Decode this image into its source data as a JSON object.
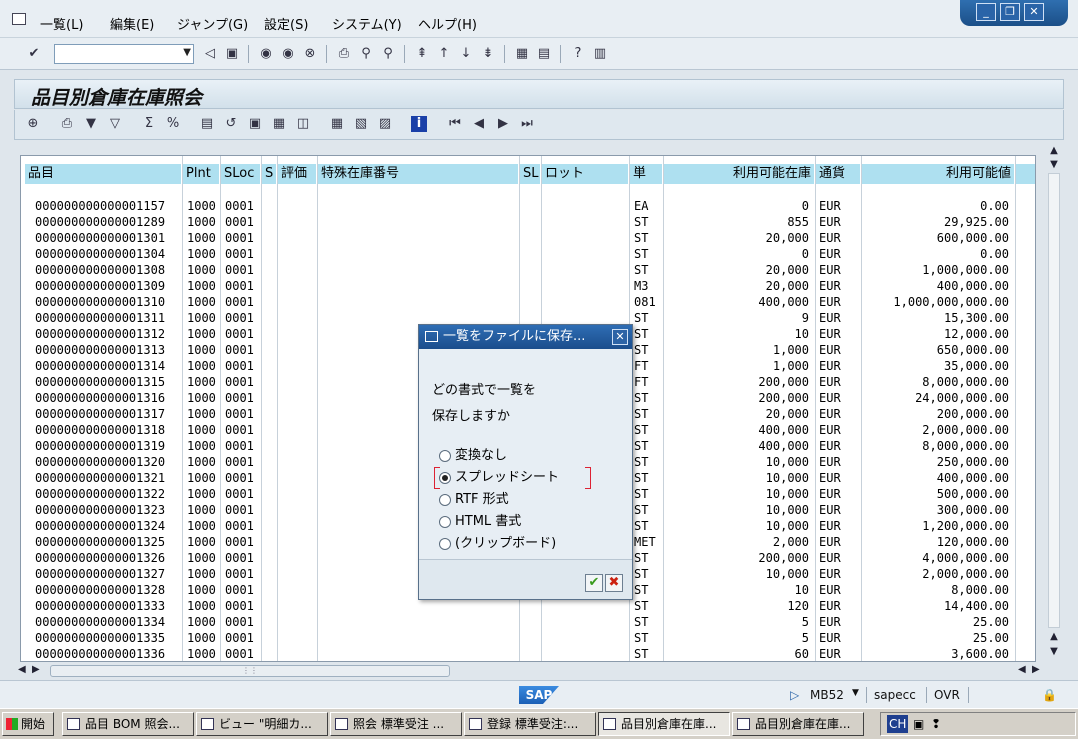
{
  "menu": {
    "items": [
      "一覧(L)",
      "編集(E)",
      "ジャンプ(G)",
      "設定(S)",
      "システム(Y)",
      "ヘルプ(H)"
    ]
  },
  "window_controls": {
    "minimize": "_",
    "restore": "❐",
    "close": "✕"
  },
  "toolbar": {
    "command_field": "",
    "icons": [
      "enter-icon",
      "back-icon",
      "save-icon",
      "back-nav-icon",
      "exit-icon",
      "cancel-icon",
      "print-icon",
      "find-icon",
      "find-next-icon",
      "first-page-icon",
      "prev-page-icon",
      "next-page-icon",
      "last-page-icon",
      "new-session-icon",
      "shortcut-icon",
      "help-icon",
      "layout-icon"
    ]
  },
  "title": "品目別倉庫在庫照会",
  "app_toolbar": {
    "icons": [
      "details-icon",
      "print-icon",
      "filter-icon",
      "filter-off-icon",
      "sum-icon",
      "subtotal-icon",
      "export-icon",
      "layout-change-icon",
      "layout-select-icon",
      "layout-save-icon",
      "abc-icon",
      "grid-icon",
      "insert-column-icon",
      "delete-column-icon",
      "info-icon",
      "first-icon",
      "prev-icon",
      "next-icon",
      "last-icon"
    ]
  },
  "grid": {
    "headers": [
      "品目",
      "Plnt",
      "SLoc",
      "S",
      "評価",
      "特殊在庫番号",
      "SL",
      "ロット",
      "単",
      "利用可能在庫",
      "通貨",
      "利用可能値"
    ],
    "rows": [
      [
        "000000000000001157",
        "1000",
        "0001",
        "EA",
        "0",
        "EUR",
        "0.00"
      ],
      [
        "000000000000001289",
        "1000",
        "0001",
        "ST",
        "855",
        "EUR",
        "29,925.00"
      ],
      [
        "000000000000001301",
        "1000",
        "0001",
        "ST",
        "20,000",
        "EUR",
        "600,000.00"
      ],
      [
        "000000000000001304",
        "1000",
        "0001",
        "ST",
        "0",
        "EUR",
        "0.00"
      ],
      [
        "000000000000001308",
        "1000",
        "0001",
        "ST",
        "20,000",
        "EUR",
        "1,000,000.00"
      ],
      [
        "000000000000001309",
        "1000",
        "0001",
        "M3",
        "20,000",
        "EUR",
        "400,000.00"
      ],
      [
        "000000000000001310",
        "1000",
        "0001",
        "081",
        "400,000",
        "EUR",
        "1,000,000,000.00"
      ],
      [
        "000000000000001311",
        "1000",
        "0001",
        "ST",
        "9",
        "EUR",
        "15,300.00"
      ],
      [
        "000000000000001312",
        "1000",
        "0001",
        "ST",
        "10",
        "EUR",
        "12,000.00"
      ],
      [
        "000000000000001313",
        "1000",
        "0001",
        "ST",
        "1,000",
        "EUR",
        "650,000.00"
      ],
      [
        "000000000000001314",
        "1000",
        "0001",
        "FT",
        "1,000",
        "EUR",
        "35,000.00"
      ],
      [
        "000000000000001315",
        "1000",
        "0001",
        "FT",
        "200,000",
        "EUR",
        "8,000,000.00"
      ],
      [
        "000000000000001316",
        "1000",
        "0001",
        "ST",
        "200,000",
        "EUR",
        "24,000,000.00"
      ],
      [
        "000000000000001317",
        "1000",
        "0001",
        "ST",
        "20,000",
        "EUR",
        "200,000.00"
      ],
      [
        "000000000000001318",
        "1000",
        "0001",
        "ST",
        "400,000",
        "EUR",
        "2,000,000.00"
      ],
      [
        "000000000000001319",
        "1000",
        "0001",
        "ST",
        "400,000",
        "EUR",
        "8,000,000.00"
      ],
      [
        "000000000000001320",
        "1000",
        "0001",
        "ST",
        "10,000",
        "EUR",
        "250,000.00"
      ],
      [
        "000000000000001321",
        "1000",
        "0001",
        "ST",
        "10,000",
        "EUR",
        "400,000.00"
      ],
      [
        "000000000000001322",
        "1000",
        "0001",
        "ST",
        "10,000",
        "EUR",
        "500,000.00"
      ],
      [
        "000000000000001323",
        "1000",
        "0001",
        "ST",
        "10,000",
        "EUR",
        "300,000.00"
      ],
      [
        "000000000000001324",
        "1000",
        "0001",
        "ST",
        "10,000",
        "EUR",
        "1,200,000.00"
      ],
      [
        "000000000000001325",
        "1000",
        "0001",
        "MET",
        "2,000",
        "EUR",
        "120,000.00"
      ],
      [
        "000000000000001326",
        "1000",
        "0001",
        "ST",
        "200,000",
        "EUR",
        "4,000,000.00"
      ],
      [
        "000000000000001327",
        "1000",
        "0001",
        "ST",
        "10,000",
        "EUR",
        "2,000,000.00"
      ],
      [
        "000000000000001328",
        "1000",
        "0001",
        "ST",
        "10",
        "EUR",
        "8,000.00"
      ],
      [
        "000000000000001333",
        "1000",
        "0001",
        "ST",
        "120",
        "EUR",
        "14,400.00"
      ],
      [
        "000000000000001334",
        "1000",
        "0001",
        "ST",
        "5",
        "EUR",
        "25.00"
      ],
      [
        "000000000000001335",
        "1000",
        "0001",
        "ST",
        "5",
        "EUR",
        "25.00"
      ],
      [
        "000000000000001336",
        "1000",
        "0001",
        "ST",
        "60",
        "EUR",
        "3,600.00"
      ]
    ]
  },
  "dialog": {
    "title": "一覧をファイルに保存...",
    "question_line1": "どの書式で一覧を",
    "question_line2": "保存しますか",
    "options": [
      "変換なし",
      "スプレッドシート",
      "RTF 形式",
      "HTML 書式",
      "(クリップボード)"
    ],
    "selected_index": 1,
    "ok_label": "✔",
    "cancel_label": "✖"
  },
  "status": {
    "logo": "SAP",
    "transaction": "MB52",
    "server": "sapecc",
    "mode": "OVR"
  },
  "taskbar": {
    "start_label": "開始",
    "buttons": [
      "品目 BOM 照会...",
      "ビュー \"明細カ...",
      "照会 標準受注 ...",
      "登録 標準受注:...",
      "品目別倉庫在庫...",
      "品目別倉庫在庫..."
    ],
    "active_index": 4,
    "tray_lang": "CH"
  }
}
